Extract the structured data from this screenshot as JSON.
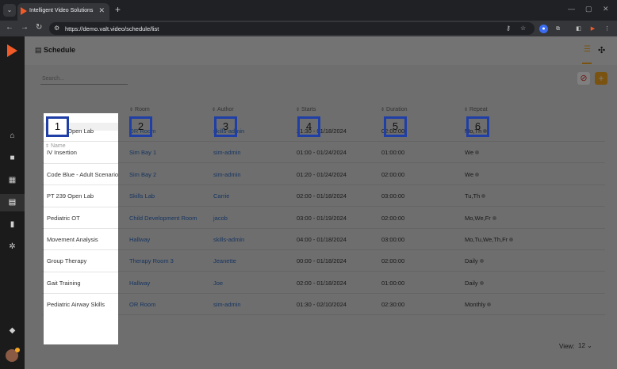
{
  "browser": {
    "tab_title": "Intelligent Video Solutions",
    "url": "https://demo.valt.video/schedule/list"
  },
  "page": {
    "title": "Schedule",
    "search_placeholder": "Search...",
    "view_label": "View:",
    "view_value": "12"
  },
  "table": {
    "headers": [
      "Name",
      "Room",
      "Author",
      "Starts",
      "Duration",
      "Repeat"
    ],
    "rows": [
      {
        "name": "PT 400 Open Lab",
        "room": "OR Room",
        "author": "skills-admin",
        "starts": "21:30 - 01/18/2024",
        "duration": "02:00:00",
        "repeat": "Mo,Th"
      },
      {
        "name": "IV Insertion",
        "room": "Sim Bay 1",
        "author": "sim-admin",
        "starts": "01:00 - 01/24/2024",
        "duration": "01:00:00",
        "repeat": "We"
      },
      {
        "name": "Code Blue - Adult Scenario",
        "room": "Sim Bay 2",
        "author": "sim-admin",
        "starts": "01:20 - 01/24/2024",
        "duration": "02:00:00",
        "repeat": "We"
      },
      {
        "name": "PT 239 Open Lab",
        "room": "Skills Lab",
        "author": "Carrie",
        "starts": "02:00 - 01/18/2024",
        "duration": "03:00:00",
        "repeat": "Tu,Th"
      },
      {
        "name": "Pediatric OT",
        "room": "Child Development Room",
        "author": "jacob",
        "starts": "03:00 - 01/19/2024",
        "duration": "02:00:00",
        "repeat": "Mo,We,Fr"
      },
      {
        "name": "Movement Analysis",
        "room": "Hallway",
        "author": "skills-admin",
        "starts": "04:00 - 01/18/2024",
        "duration": "03:00:00",
        "repeat": "Mo,Tu,We,Th,Fr"
      },
      {
        "name": "Group Therapy",
        "room": "Therapy Room 3",
        "author": "Jeanette",
        "starts": "00:00 - 01/18/2024",
        "duration": "02:00:00",
        "repeat": "Daily"
      },
      {
        "name": "Gait Training",
        "room": "Hallway",
        "author": "Joe",
        "starts": "02:00 - 01/18/2024",
        "duration": "01:00:00",
        "repeat": "Daily"
      },
      {
        "name": "Pediatric Airway Skills",
        "room": "OR Room",
        "author": "sim-admin",
        "starts": "01:30 - 02/10/2024",
        "duration": "02:30:00",
        "repeat": "Monthly"
      }
    ]
  },
  "callouts": [
    "1",
    "2",
    "3",
    "4",
    "5",
    "6"
  ],
  "colors": {
    "accent": "#f5a623",
    "brand": "#f05a28",
    "link": "#2e6bc2",
    "callout_border": "#1f3fa6"
  }
}
